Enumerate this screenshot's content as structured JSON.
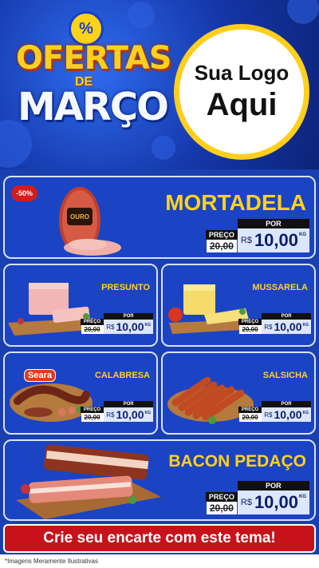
{
  "hero": {
    "percent": "%",
    "title_line1": "OFERTAS",
    "title_de": "DE",
    "title_line2": "MARÇO",
    "logo_line1": "Sua Logo",
    "logo_line2": "Aqui"
  },
  "products": [
    {
      "name": "MORTADELA",
      "badge": "-50%",
      "preco_label": "PREÇO",
      "old_price": "20,00",
      "por_label": "POR",
      "currency": "R$",
      "price": "10,00",
      "unit": "KG"
    },
    {
      "name": "PRESUNTO",
      "preco_label": "PREÇO",
      "old_price": "20,00",
      "por_label": "POR",
      "currency": "R$",
      "price": "10,00",
      "unit": "KG"
    },
    {
      "name": "MUSSARELA",
      "preco_label": "PREÇO",
      "old_price": "20,00",
      "por_label": "POR",
      "currency": "R$",
      "price": "10,00",
      "unit": "KG"
    },
    {
      "name": "CALABRESA",
      "brand": "Seara",
      "preco_label": "PREÇO",
      "old_price": "20,00",
      "por_label": "POR",
      "currency": "R$",
      "price": "10,00",
      "unit": "KG"
    },
    {
      "name": "SALSICHA",
      "preco_label": "PREÇO",
      "old_price": "20,00",
      "por_label": "POR",
      "currency": "R$",
      "price": "10,00",
      "unit": "KG"
    },
    {
      "name": "BACON PEDAÇO",
      "preco_label": "PREÇO",
      "old_price": "20,00",
      "por_label": "POR",
      "currency": "R$",
      "price": "10,00",
      "unit": "KG"
    }
  ],
  "mortadela_brand": "OURO",
  "cta": "Crie seu encarte com este tema!",
  "footer": "*Imagens Meramente Ilustrativas"
}
